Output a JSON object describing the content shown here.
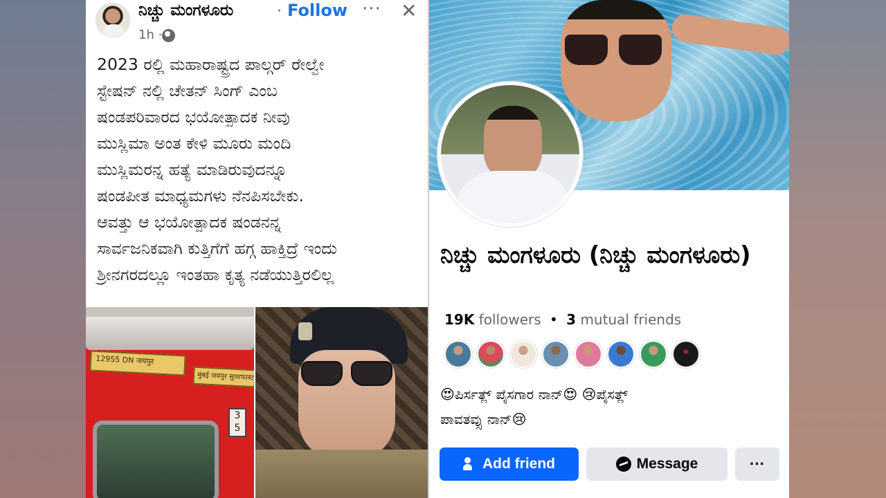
{
  "post": {
    "author": "ನಿಚ್ಚು ಮಂಗಳೂರು",
    "separator": "·",
    "follow_label": "Follow",
    "more_label": "···",
    "close_label": "✕",
    "time": "1h ·",
    "text_lines": [
      "2023 ರಲ್ಲಿ ಮಹಾರಾಷ್ಟ್ರದ ಪಾಲ್ಗರ್ ರೇಲ್ವೇ",
      "ಸ್ಟೇಷನ್ ನಲ್ಲಿ ಚೇತನ್ ಸಿಂಗ್ ಎಂಬ",
      "ಷಂಡಪರಿವಾರದ ಭಯೋತ್ಪಾದಕ ನೀವು",
      "ಮುಸ್ಲಿಮಾ ಅಂತ ಕೇಳಿ ಮೂರು ಮಂದಿ",
      "ಮುಸ್ಲಿಮರನ್ನ ಹತ್ಯೆ ಮಾಡಿರುವುದನ್ನೂ",
      "ಷಂಡಪೀತ ಮಾಧ್ಯಮಗಳು ನೆನಪಿಸಬೇಕು.",
      "ಆವತ್ತು ಆ ಭಯೋತ್ಪಾದಕ ಷಂಡನನ್ನ",
      "ಸಾರ್ವಜನಿಕವಾಗಿ ಕುತ್ತಿಗೆಗೆ ಹಗ್ಗ ಹಾಕ್ತಿದ್ರೆ ಇಂದು",
      "ಶ್ರೀನಗರದಲ್ಲೂ ಇಂತಹಾ ಕೃತ್ಯ ನಡೆಯುತ್ತಿರಲಿಲ್ಲ"
    ],
    "train_plate_1": "12955 DN  जयपुर",
    "train_plate_2": "मुंबई जयपुर सुपरफास्ट",
    "train_number": "3 5"
  },
  "profile": {
    "name": "ನಿಚ್ಚು ಮಂಗಳೂರು (ನಿಚ್ಚು ಮಂಗಳೂರು)",
    "followers_count": "19K",
    "followers_label": "followers",
    "stats_separator": "•",
    "mutual_count": "3",
    "mutual_label": "mutual friends",
    "bio_lines": [
      "😍ಪಿರ್ಸತ್ಲ್   ಪೈಸಗಾರ ನಾನ್😍 😢ಪೈಸತ್ಲ್",
      "ಪಾವತವ್ಸು ನಾನ್😢"
    ],
    "add_friend_label": "Add friend",
    "message_label": "Message",
    "more_label": "···"
  },
  "colors": {
    "accent": "#0866ff",
    "follow": "#1b74e4",
    "secondary_button": "#e4e6eb",
    "muted_text": "#65676b"
  }
}
